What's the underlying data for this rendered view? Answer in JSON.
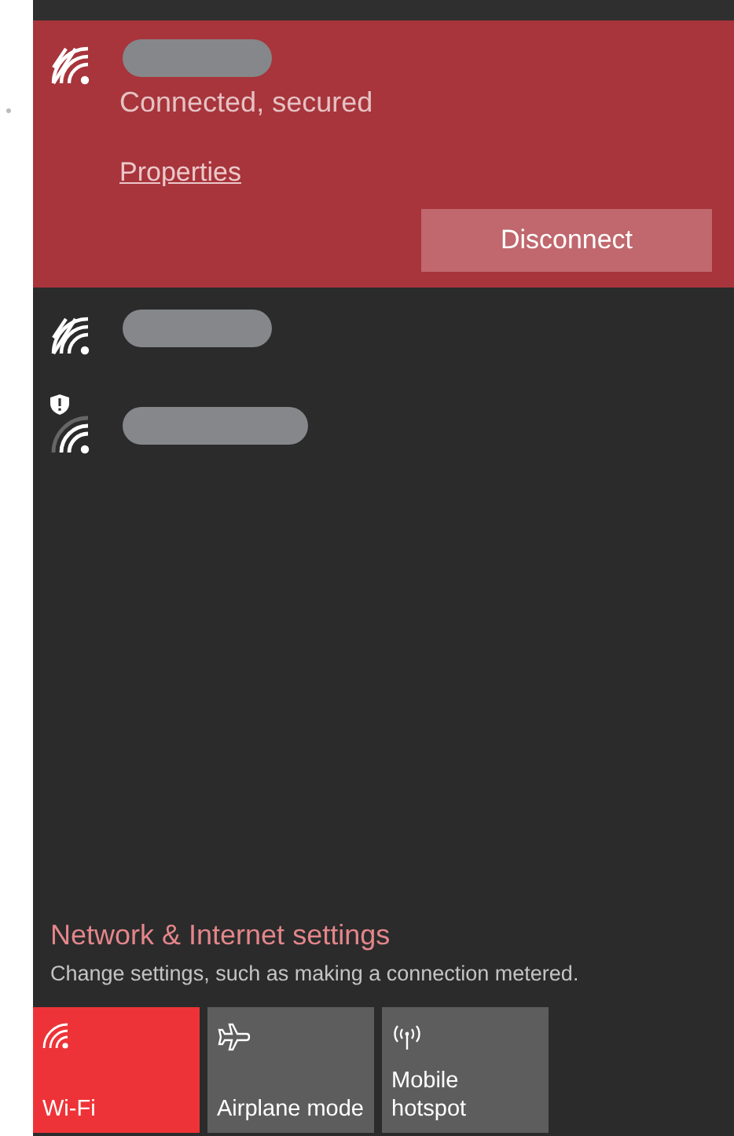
{
  "networks": [
    {
      "selected": true,
      "warning": false,
      "status": "Connected, secured",
      "link": "Properties",
      "button": "Disconnect"
    },
    {
      "selected": false,
      "warning": false
    },
    {
      "selected": false,
      "warning": true
    }
  ],
  "settings": {
    "title": "Network & Internet settings",
    "description": "Change settings, such as making a connection metered."
  },
  "tiles": [
    {
      "kind": "wifi",
      "label": "Wi-Fi",
      "on": true
    },
    {
      "kind": "airplane",
      "label": "Airplane mode",
      "on": false
    },
    {
      "kind": "hotspot",
      "label": "Mobile hotspot",
      "on": false
    }
  ]
}
